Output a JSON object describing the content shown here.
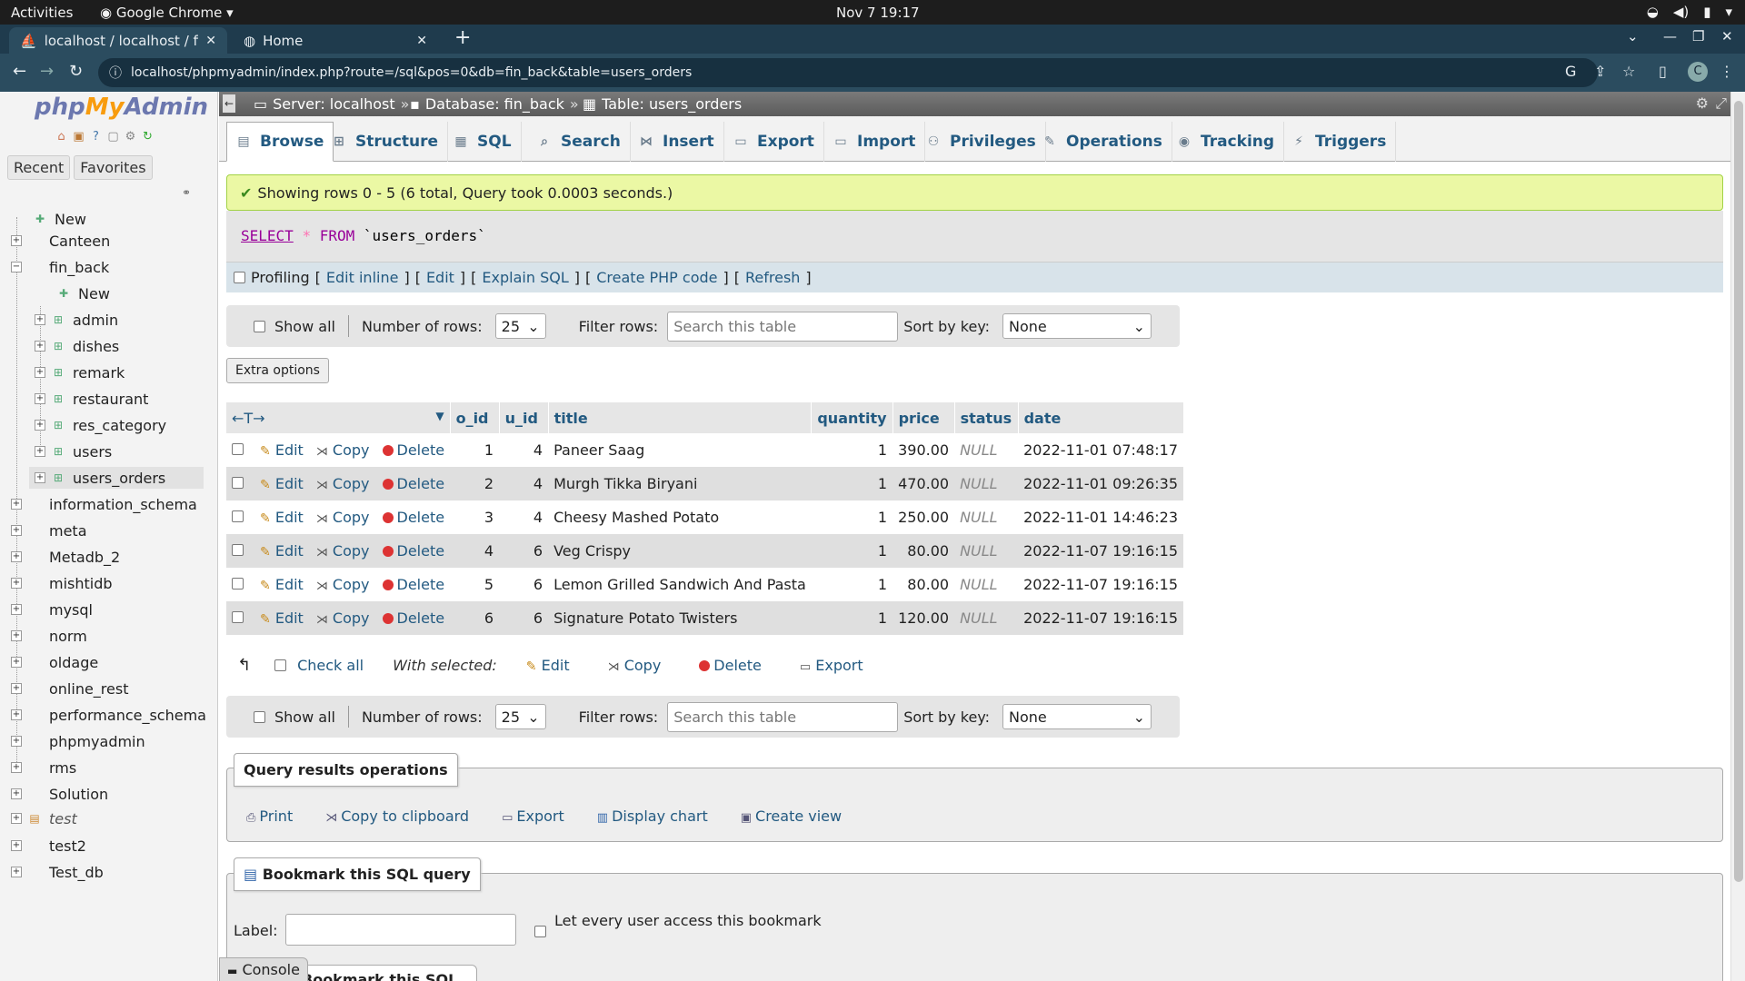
{
  "os": {
    "activities": "Activities",
    "app_name": "Google Chrome",
    "clock": "Nov 7  19:17"
  },
  "browser": {
    "tabs": [
      {
        "label": "localhost / localhost / fin_"
      },
      {
        "label": "Home"
      }
    ],
    "url": "localhost/phpmyadmin/index.php?route=/sql&pos=0&db=fin_back&table=users_orders",
    "avatar_letter": "C"
  },
  "sidebar": {
    "logo_php": "php",
    "logo_my": "My",
    "logo_admin": "Admin",
    "tabs": [
      "Recent",
      "Favorites"
    ],
    "tree": [
      {
        "label": "New",
        "level": 0
      },
      {
        "label": "Canteen",
        "level": 0
      },
      {
        "label": "fin_back",
        "level": 0
      },
      {
        "label": "New",
        "level": 1
      },
      {
        "label": "admin",
        "level": 1
      },
      {
        "label": "dishes",
        "level": 1
      },
      {
        "label": "remark",
        "level": 1
      },
      {
        "label": "restaurant",
        "level": 1
      },
      {
        "label": "res_category",
        "level": 1
      },
      {
        "label": "users",
        "level": 1
      },
      {
        "label": "users_orders",
        "level": 1
      },
      {
        "label": "information_schema",
        "level": 0
      },
      {
        "label": "meta",
        "level": 0
      },
      {
        "label": "Metadb_2",
        "level": 0
      },
      {
        "label": "mishtidb",
        "level": 0
      },
      {
        "label": "mysql",
        "level": 0
      },
      {
        "label": "norm",
        "level": 0
      },
      {
        "label": "oldage",
        "level": 0
      },
      {
        "label": "online_rest",
        "level": 0
      },
      {
        "label": "performance_schema",
        "level": 0
      },
      {
        "label": "phpmyadmin",
        "level": 0
      },
      {
        "label": "rms",
        "level": 0
      },
      {
        "label": "Solution",
        "level": 0
      },
      {
        "label": "test",
        "level": 0
      },
      {
        "label": "test2",
        "level": 0
      },
      {
        "label": "Test_db",
        "level": 0
      }
    ]
  },
  "breadcrumb": {
    "server": "Server: localhost",
    "database": "Database: fin_back",
    "table": "Table: users_orders",
    "separator": "»"
  },
  "menu": [
    "Browse",
    "Structure",
    "SQL",
    "Search",
    "Insert",
    "Export",
    "Import",
    "Privileges",
    "Operations",
    "Tracking",
    "Triggers"
  ],
  "result": {
    "message": "Showing rows 0 - 5 (6 total, Query took 0.0003 seconds.)",
    "sql_select": "SELECT",
    "sql_star": "*",
    "sql_from": "FROM",
    "sql_table": "`users_orders`"
  },
  "profiling": {
    "label": "Profiling",
    "links": [
      "Edit inline",
      "Edit",
      "Explain SQL",
      "Create PHP code",
      "Refresh"
    ]
  },
  "nav": {
    "show_all": "Show all",
    "num_rows_label": "Number of rows:",
    "num_rows": "25",
    "filter_label": "Filter rows:",
    "filter_placeholder": "Search this table",
    "sort_label": "Sort by key:",
    "sort_value": "None"
  },
  "extra_options": "Extra options",
  "table": {
    "columns": [
      "o_id",
      "u_id",
      "title",
      "quantity",
      "price",
      "status",
      "date"
    ],
    "actions": [
      "Edit",
      "Copy",
      "Delete"
    ],
    "rows": [
      [
        "1",
        "4",
        "Paneer Saag",
        "1",
        "390.00",
        "NULL",
        "2022-11-01 07:48:17"
      ],
      [
        "2",
        "4",
        "Murgh Tikka Biryani",
        "1",
        "470.00",
        "NULL",
        "2022-11-01 09:26:35"
      ],
      [
        "3",
        "4",
        "Cheesy Mashed Potato",
        "1",
        "250.00",
        "NULL",
        "2022-11-01 14:46:23"
      ],
      [
        "4",
        "6",
        "Veg Crispy",
        "1",
        "80.00",
        "NULL",
        "2022-11-07 19:16:15"
      ],
      [
        "5",
        "6",
        "Lemon Grilled Sandwich And Pasta",
        "1",
        "80.00",
        "NULL",
        "2022-11-07 19:16:15"
      ],
      [
        "6",
        "6",
        "Signature Potato Twisters",
        "1",
        "120.00",
        "NULL",
        "2022-11-07 19:16:15"
      ]
    ]
  },
  "with_selected": {
    "check_all": "Check all",
    "label": "With selected:",
    "actions": [
      "Edit",
      "Copy",
      "Delete",
      "Export"
    ]
  },
  "query_ops": {
    "title": "Query results operations",
    "links": [
      "Print",
      "Copy to clipboard",
      "Export",
      "Display chart",
      "Create view"
    ]
  },
  "bookmark": {
    "title": "Bookmark this SQL query",
    "label": "Label:",
    "let_every_user": "Let every user access this bookmark",
    "ghost_title": "Bookmark this SQL query"
  },
  "console": "Console"
}
